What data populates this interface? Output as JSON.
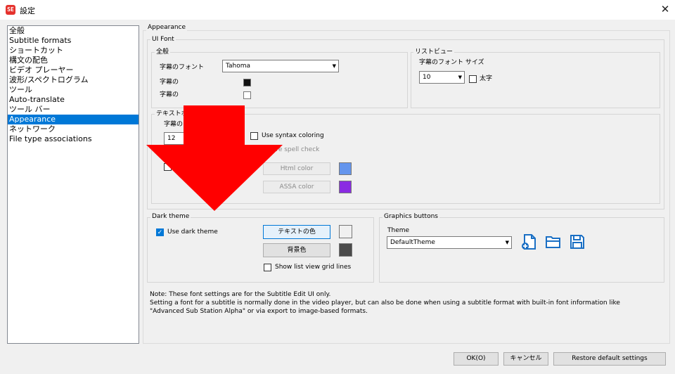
{
  "window": {
    "title": "設定",
    "app_icon_text": "SE"
  },
  "nav": {
    "items": [
      "全般",
      "Subtitle formats",
      "ショートカット",
      "構文の配色",
      "ビデオ プレーヤー",
      "波形/スペクトログラム",
      "ツール",
      "Auto-translate",
      "ツール バー",
      "Appearance",
      "ネットワーク",
      "File type associations"
    ],
    "selected_index": 9
  },
  "appearance": {
    "section_title": "Appearance",
    "ui_font": {
      "title": "UI Font",
      "general": {
        "title": "全般",
        "font_label": "字幕のフォント",
        "font_value": "Tahoma",
        "color_label_1": "字幕の",
        "color_label_2": "字幕の"
      },
      "listview": {
        "title": "リストビュー",
        "size_label": "字幕のフォント サイズ",
        "size_value": "10",
        "bold_label": "太字"
      },
      "textbox": {
        "title": "テキストボ",
        "size_label": "字幕の",
        "size_value": "12",
        "syntax_label": "Use syntax coloring",
        "spell_label": "ive spell check",
        "html_color_label": "Html color",
        "assa_color_label": "ASSA color",
        "html_color": "#6495ed",
        "assa_color": "#8a2be2"
      }
    },
    "dark_theme": {
      "title": "Dark theme",
      "use_label": "Use dark theme",
      "use_checked": true,
      "text_color_button": "テキストの色",
      "bg_color_button": "背景色",
      "text_color": "#f0f0f0",
      "bg_color": "#4a4a4a",
      "grid_label": "Show list view grid lines"
    },
    "graphics": {
      "title": "Graphics buttons",
      "theme_label": "Theme",
      "theme_value": "DefaultTheme"
    },
    "note": [
      "Note: These font settings are for the Subtitle Edit UI only.",
      "Setting a font for a subtitle is normally done in the video player, but can also be done when using a subtitle format with built-in font information like",
      "\"Advanced Sub Station Alpha\" or via export to image-based formats."
    ]
  },
  "buttons": {
    "ok": "OK(O)",
    "cancel": "キャンセル",
    "restore": "Restore default settings"
  },
  "overlay": {
    "arrow_color": "#ff0000"
  }
}
